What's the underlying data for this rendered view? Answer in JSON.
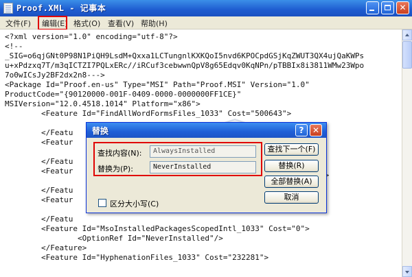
{
  "window": {
    "title": "Proof.XML - 记事本",
    "controls": {
      "minimize": "",
      "maximize": "",
      "close": "✕"
    }
  },
  "menu": {
    "file": "文件(F)",
    "edit": "编辑(E)",
    "format": "格式(O)",
    "view": "查看(V)",
    "help": "帮助(H)"
  },
  "editor": {
    "lines": [
      "<?xml version=\"1.0\" encoding=\"utf-8\"?>",
      "<!--",
      "_SIG=o6qjGNt0P98N1PiQH9LsdM+Qxxa1LCTungnlKXKQoI5nvd6KPOCpdGSjKqZWUT3QX4ujQaKWPs",
      "u+xPdzxq7T/m3qICTZI7PQLxERc//iRCuf3cebwwnQpV8g65Edqv0KqNPn/pTBBIx8i3811WMw23Wpo",
      "7o0wICsJy2BF2dx2n8--->",
      "<Package Id=\"Proof.en-us\" Type=\"MSI\" Path=\"Proof.MSI\" Version=\"1.0\"",
      "ProductCode=\"{90120000-001F-0409-0000-0000000FF1CE}\"",
      "MSIVersion=\"12.0.4518.1014\" Platform=\"x86\">",
      "        <Feature Id=\"FindAllWordFormsFiles_1033\" Cost=\"500643\">",
      "",
      "        </Featu",
      "        <Featur",
      "",
      "        </Featu",
      "        <Featur",
      "",
      "        </Featu",
      "        <Featur",
      "",
      "        </Featu",
      "        <Feature Id=\"MsoInstalledPackagesScopedIntl_1033\" Cost=\"0\">",
      "                <OptionRef Id=\"NeverInstalled\"/>",
      "        </Feature>",
      "        <Feature Id=\"HyphenationFiles_1033\" Cost=\"232281\">"
    ],
    "fragment": "\">"
  },
  "dialog": {
    "title": "替换",
    "help_glyph": "?",
    "close_glyph": "✕",
    "find_label": "查找内容(N):",
    "find_value": "AlwaysInstalled",
    "replace_label": "替换为(P):",
    "replace_value": "NeverInstalled",
    "find_next_button": "查找下一个(F)",
    "replace_button": "替换(R)",
    "replace_all_button": "全部替换(A)",
    "cancel_button": "取消",
    "match_case_label": "区分大小写(C)"
  },
  "watermark": {
    "text": "安下载"
  },
  "colors": {
    "highlight_red": "#e00000",
    "titlebar_blue": "#1e5cd0"
  }
}
